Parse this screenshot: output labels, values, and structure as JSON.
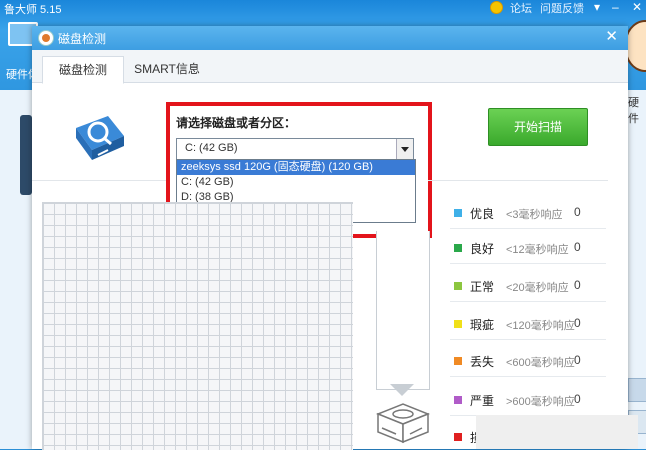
{
  "background_app": {
    "title": "鲁大师 5.15",
    "links": [
      "论坛",
      "问题反馈"
    ],
    "sidebar_label": "硬件体",
    "right_label": "硬件"
  },
  "dialog": {
    "title": "磁盘检测",
    "tabs": [
      {
        "label": "磁盘检测",
        "active": true
      },
      {
        "label": "SMART信息",
        "active": false
      }
    ],
    "select": {
      "label": "请选择磁盘或者分区：",
      "value": "C:  (42 GB)",
      "options": [
        {
          "label": "zeeksys ssd 120G (固态硬盘)  (120 GB)",
          "selected": true
        },
        {
          "label": "C:  (42 GB)",
          "selected": false
        },
        {
          "label": "D:  (38 GB)",
          "selected": false
        },
        {
          "label": "E:  (38 GB)",
          "selected": false
        }
      ]
    },
    "scan_button": "开始扫描",
    "legend": [
      {
        "name": "优良",
        "desc": "<3毫秒响应",
        "count": "0",
        "color": "#3fb0e8"
      },
      {
        "name": "良好",
        "desc": "<12毫秒响应",
        "count": "0",
        "color": "#2aa84a"
      },
      {
        "name": "正常",
        "desc": "<20毫秒响应",
        "count": "0",
        "color": "#8cc63f"
      },
      {
        "name": "瑕疵",
        "desc": "<120毫秒响应",
        "count": "0",
        "color": "#f0e019"
      },
      {
        "name": "丢失",
        "desc": "<600毫秒响应",
        "count": "0",
        "color": "#f08a24"
      },
      {
        "name": "严重",
        "desc": ">600毫秒响应",
        "count": "0",
        "color": "#b05bc8"
      },
      {
        "name": "损",
        "desc": "",
        "count": "",
        "color": "#e02020"
      }
    ]
  }
}
